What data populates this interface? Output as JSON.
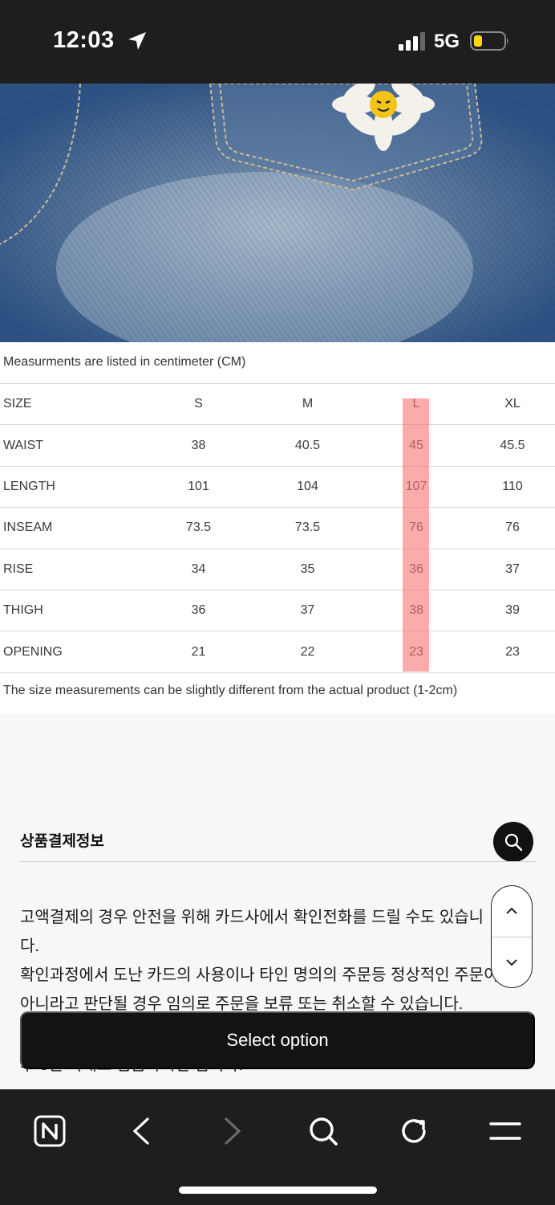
{
  "status_bar": {
    "time": "12:03",
    "network": "5G"
  },
  "size_chart": {
    "note_top": "Measurments are listed in centimeter (CM)",
    "header": {
      "label": "SIZE",
      "sizes": [
        "S",
        "M",
        "L",
        "XL"
      ]
    },
    "rows": [
      {
        "label": "WAIST",
        "values": [
          "38",
          "40.5",
          "45",
          "45.5"
        ]
      },
      {
        "label": "LENGTH",
        "values": [
          "101",
          "104",
          "107",
          "110"
        ]
      },
      {
        "label": "INSEAM",
        "values": [
          "73.5",
          "73.5",
          "76",
          "76"
        ]
      },
      {
        "label": "RISE",
        "values": [
          "34",
          "35",
          "36",
          "37"
        ]
      },
      {
        "label": "THIGH",
        "values": [
          "36",
          "37",
          "38",
          "39"
        ]
      },
      {
        "label": "OPENING",
        "values": [
          "21",
          "22",
          "23",
          "23"
        ]
      }
    ],
    "highlighted_size": "L",
    "note_bottom": "The size measurements can be slightly different from the actual product (1-2cm)"
  },
  "payment_info": {
    "title": "상품결제정보",
    "lines": [
      "고액결제의 경우 안전을 위해 카드사에서 확인전화를 드릴 수도 있습니",
      "다.",
      "확인과정에서 도난 카드의 사용이나 타인 명의의 주문등 정상적인 주문이",
      "아니라고 판단될 경우 임의로 주문을 보류 또는 취소할 수 있습니다."
    ],
    "partial_line": "후 3일 이내로 입금하시면 됩니다."
  },
  "buttons": {
    "select_option": "Select option"
  },
  "icons": {
    "location": "location-arrow-icon",
    "signal": "cellular-signal-icon",
    "battery": "battery-icon",
    "search": "search-icon",
    "scroll_up": "chevron-up-icon",
    "scroll_down": "chevron-down-icon",
    "naver": "naver-n-icon",
    "back": "chevron-left-icon",
    "forward": "chevron-right-icon",
    "refresh": "refresh-icon",
    "menu": "menu-icon"
  },
  "colors": {
    "highlight": "#f87878",
    "battery_level": "#ffd60a",
    "button_bg": "#131313"
  }
}
